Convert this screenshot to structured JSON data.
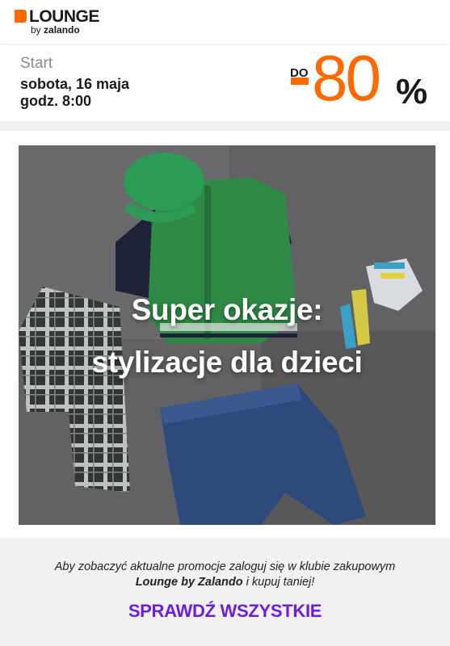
{
  "header": {
    "logo_text": "LOUNGE",
    "logo_sub_prefix": "by ",
    "logo_sub_brand": "zalando"
  },
  "start": {
    "label": "Start",
    "date": "sobota, 16 maja",
    "time": "godz. 8:00"
  },
  "discount": {
    "prefix": "DO",
    "value": "-80",
    "percent": "%",
    "accent_color": "#ff6a00"
  },
  "banner": {
    "title_line1": "Super okazje:",
    "title_line2": "stylizacje dla dzieci"
  },
  "footer": {
    "info_line1": "Aby zobaczyć aktualne promocje zaloguj się w klubie zakupowym",
    "info_brand": "Lounge by Zalando",
    "info_line2_rest": " i kupuj taniej!",
    "cta_label": "SPRAWDŹ WSZYSTKIE",
    "cta_color": "#6a1fe0"
  }
}
